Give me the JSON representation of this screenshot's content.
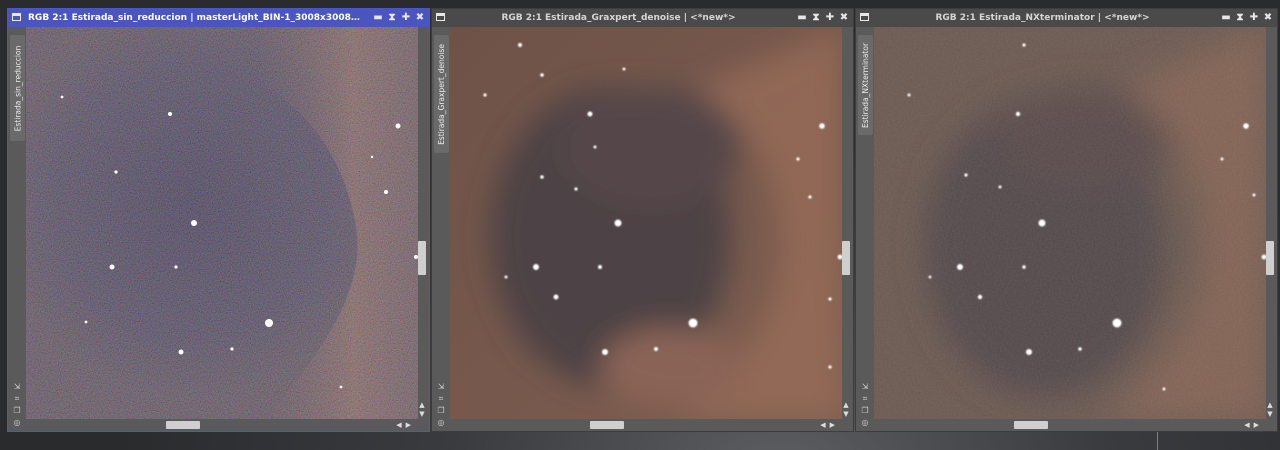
{
  "windows": [
    {
      "id": "sin-reduccion",
      "title": "RGB 2:1 Estirada_sin_reduccion | masterLight_BIN-1_3008x3008_EXPOS...",
      "side_tab": "Estirada_sin_reduccion",
      "active": true
    },
    {
      "id": "graxpert",
      "title": "RGB 2:1 Estirada_Graxpert_denoise | <*new*>",
      "side_tab": "Estirada_Graxpert_denoise",
      "active": false
    },
    {
      "id": "nxterminator",
      "title": "RGB 2:1 Estirada_NXterminator | <*new*>",
      "side_tab": "Estirada_NXterminator",
      "active": false
    }
  ],
  "icons": {
    "window": "window-icon",
    "minimize": "minimize-icon",
    "shade": "shade-icon",
    "maximize": "maximize-icon",
    "close": "close-icon",
    "scroll_up": "arrow-up-icon",
    "scroll_down": "arrow-down-icon",
    "scroll_left": "arrow-left-icon",
    "scroll_right": "arrow-right-icon",
    "zoom_fit": "zoom-fit-icon",
    "fit_window": "fit-window-icon",
    "clone": "clone-icon",
    "settings": "settings-icon"
  },
  "colors": {
    "active_title": "#4b55c0",
    "inactive_title": "#4a4a4a",
    "window_frame": "#5a5a5a",
    "desktop": "#2a2b2d"
  }
}
